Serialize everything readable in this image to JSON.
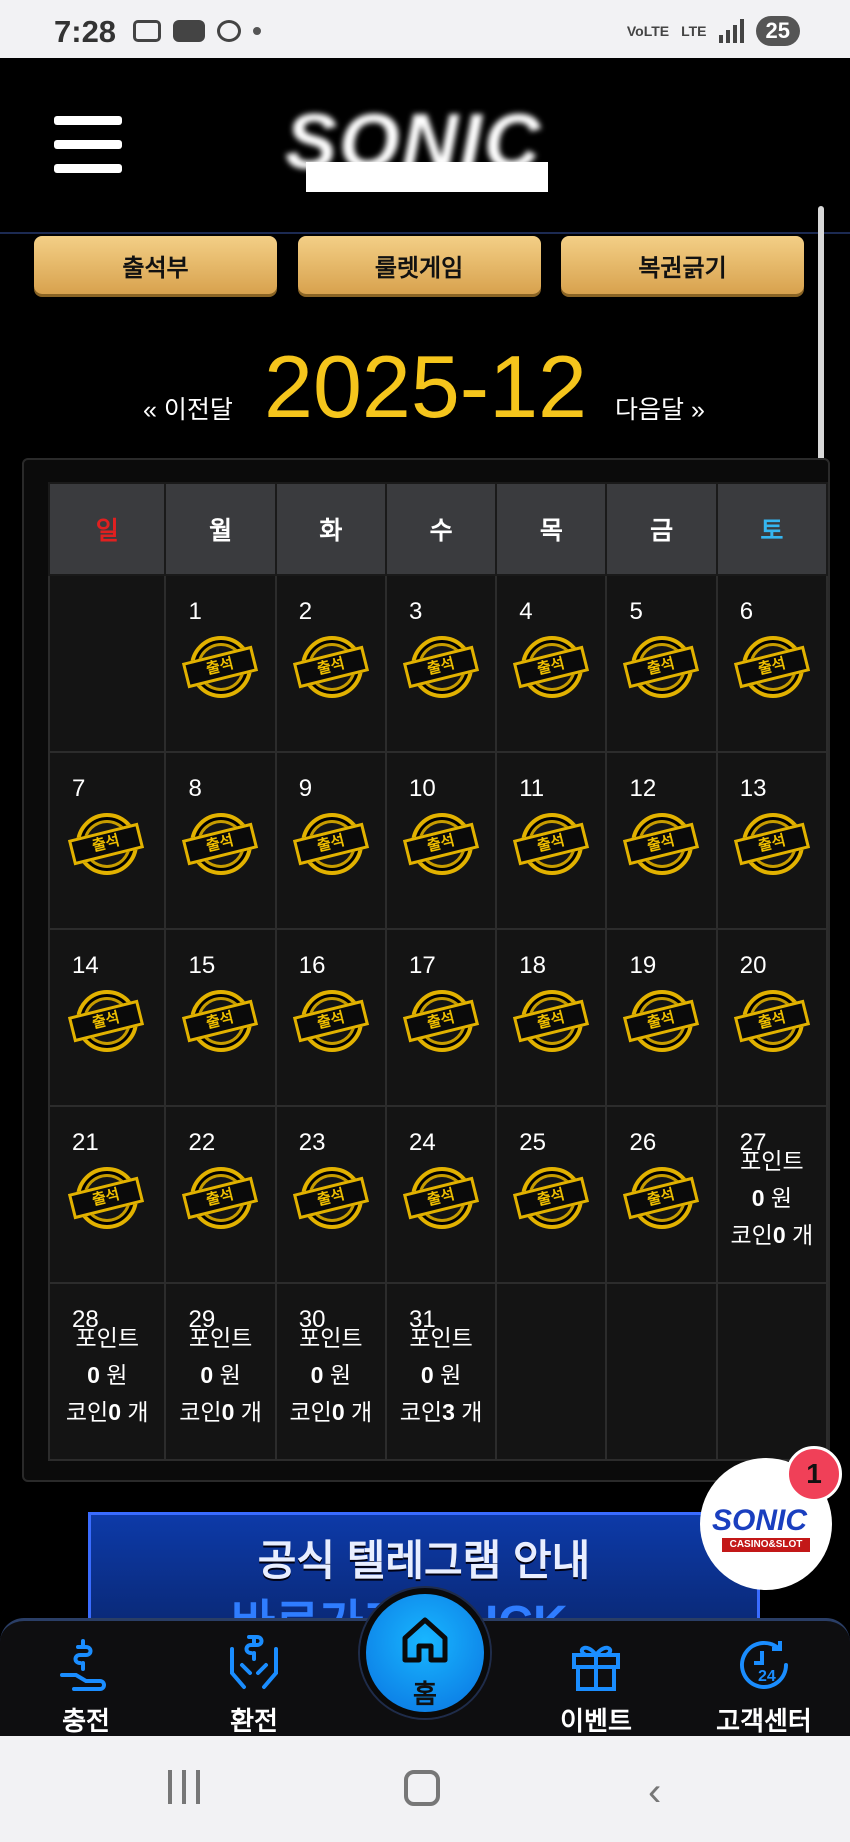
{
  "status": {
    "time": "7:28",
    "lte": "LTE",
    "volte": "VoLTE",
    "battery": "25"
  },
  "topButtons": [
    "출석부",
    "룰렛게임",
    "복권긁기"
  ],
  "nav": {
    "prev": "« 이전달",
    "month": "2025-12",
    "next": "다음달 »"
  },
  "weekdays": [
    "일",
    "월",
    "화",
    "수",
    "목",
    "금",
    "토"
  ],
  "stampText": "출석",
  "attendedDays": [
    1,
    2,
    3,
    4,
    5,
    6,
    7,
    8,
    9,
    10,
    11,
    12,
    13,
    14,
    15,
    16,
    17,
    18,
    19,
    20,
    21,
    22,
    23,
    24,
    25,
    26
  ],
  "summaryDays": [
    {
      "day": "27",
      "pointsLabel": "포인트",
      "points": "0",
      "pointsUnit": "원",
      "coinLabel": "코인",
      "coins": "0",
      "coinUnit": "개"
    },
    {
      "day": "28",
      "pointsLabel": "포인트",
      "points": "0",
      "pointsUnit": "원",
      "coinLabel": "코인",
      "coins": "0",
      "coinUnit": "개"
    },
    {
      "day": "29",
      "pointsLabel": "포인트",
      "points": "0",
      "pointsUnit": "원",
      "coinLabel": "코인",
      "coins": "0",
      "coinUnit": "개"
    },
    {
      "day": "30",
      "pointsLabel": "포인트",
      "points": "0",
      "pointsUnit": "원",
      "coinLabel": "코인",
      "coins": "0",
      "coinUnit": "개"
    },
    {
      "day": "31",
      "pointsLabel": "포인트",
      "points": "0",
      "pointsUnit": "원",
      "coinLabel": "코인",
      "coins": "3",
      "coinUnit": "개"
    }
  ],
  "banner": {
    "title": "공식 텔레그램 안내",
    "sub": "바로가기 CLICK"
  },
  "floatBadge": {
    "brand": "SONIC",
    "sub": "CASINO&SLOT",
    "count": "1"
  },
  "bottomNav": {
    "charge": "충전",
    "exchange": "환전",
    "home": "홈",
    "event": "이벤트",
    "support": "고객센터"
  },
  "colors": {
    "accent": "#f5c51c",
    "buttonGold": "#e3b465",
    "sunday": "#e02020",
    "saturday": "#35b6f0",
    "homeBlue": "#129cf5"
  }
}
